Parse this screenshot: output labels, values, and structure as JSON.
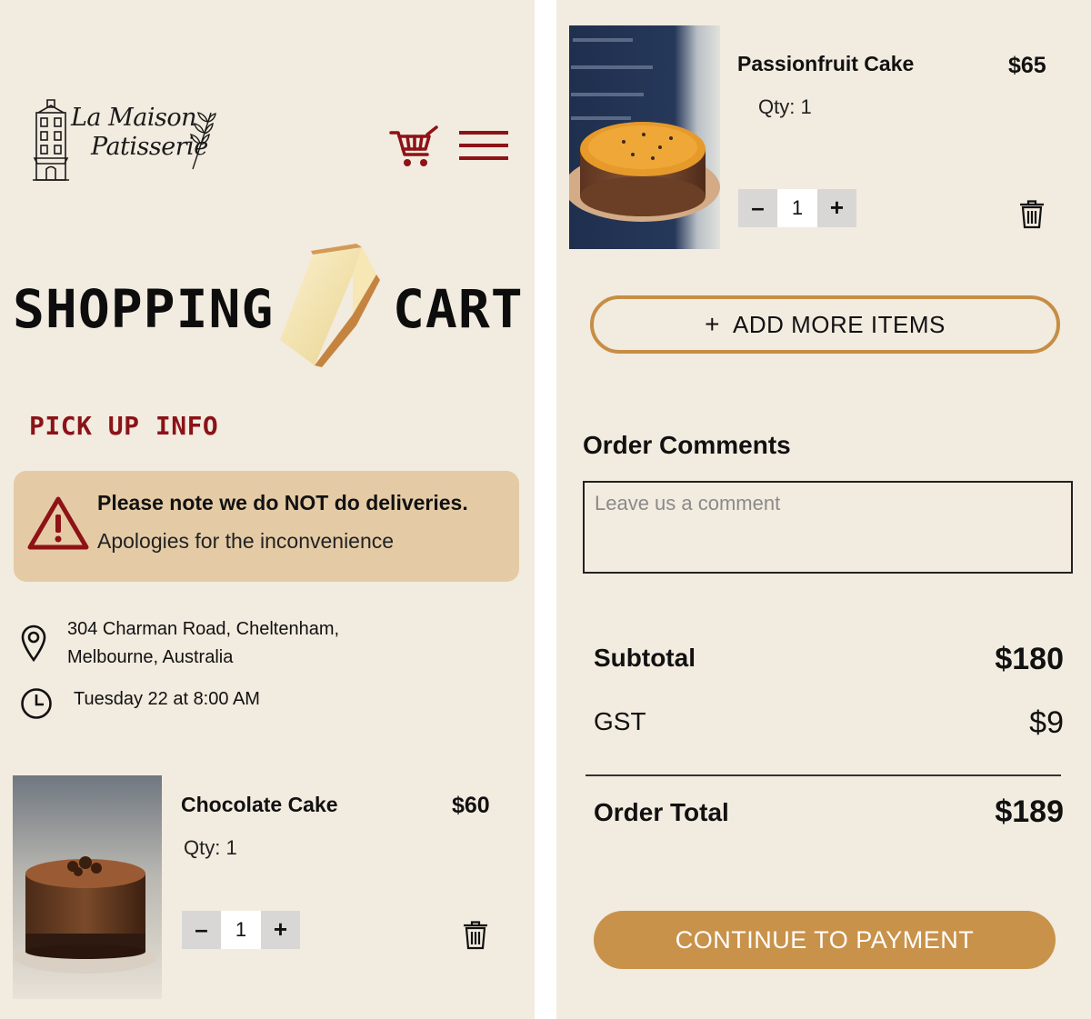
{
  "brand": {
    "logo_line1": "La Maison",
    "logo_line2": "Patisserie"
  },
  "header": {
    "cart_icon": "shopping-cart-icon",
    "menu_icon": "hamburger-menu-icon"
  },
  "page_title": {
    "word1": "SHOPPING",
    "word2": "CART"
  },
  "pickup": {
    "heading": "PICK UP INFO",
    "notice_title": "Please note we do NOT do deliveries.",
    "notice_body": "Apologies for the inconvenience",
    "address_line1": "304 Charman Road, Cheltenham,",
    "address_line2": "Melbourne, Australia",
    "datetime": "Tuesday 22  at 8:00 AM"
  },
  "cart_items": [
    {
      "name": "Chocolate Cake",
      "price": "$60",
      "qty_label": "Qty: 1",
      "quantity": "1",
      "minus": "–",
      "plus": "+"
    },
    {
      "name": "Passionfruit Cake",
      "price": "$65",
      "qty_label": "Qty: 1",
      "quantity": "1",
      "minus": "–",
      "plus": "+"
    }
  ],
  "actions": {
    "add_more_plus": "+",
    "add_more_label": "ADD MORE ITEMS",
    "pay_label": "CONTINUE TO PAYMENT"
  },
  "comments": {
    "heading": "Order Comments",
    "placeholder": "Leave us a comment"
  },
  "summary": {
    "subtotal_label": "Subtotal",
    "subtotal_value": "$180",
    "gst_label": "GST",
    "gst_value": "$9",
    "total_label": "Order Total",
    "total_value": "$189"
  },
  "colors": {
    "background": "#f2ebdf",
    "accent_red": "#8e1216",
    "notice_bg": "#e4cba6",
    "gold": "#c9924a"
  }
}
